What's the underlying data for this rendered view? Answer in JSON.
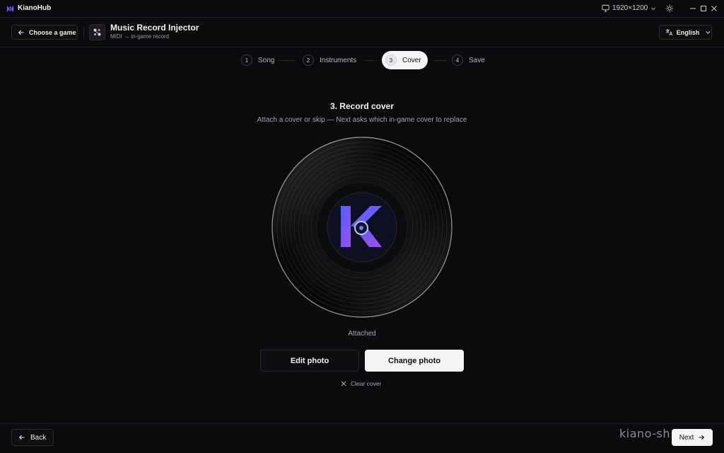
{
  "app": {
    "name": "KianoHub",
    "resolution": "1920×1200"
  },
  "icons": {
    "app_logo": "kianohub-logo-icon",
    "monitor": "monitor-icon",
    "sun": "sun-icon",
    "minimize": "minimize-icon",
    "maximize": "maximize-icon",
    "close": "close-icon",
    "back_arrow": "arrow-left-icon",
    "translate": "translate-icon",
    "chevron": "chevron-down-icon",
    "clear": "x-icon",
    "next_arrow": "arrow-right-icon"
  },
  "header": {
    "choose_game": "Choose a game",
    "tool_title": "Music Record Injector",
    "tool_subtitle": "MIDI → in-game record",
    "language": "English"
  },
  "steps": [
    {
      "num": "1",
      "label": "Song",
      "active": false
    },
    {
      "num": "2",
      "label": "Instruments",
      "active": false
    },
    {
      "num": "3",
      "label": "Cover",
      "active": true
    },
    {
      "num": "4",
      "label": "Save",
      "active": false
    }
  ],
  "content": {
    "title": "3. Record cover",
    "description": "Attach a cover or skip — Next asks which in-game cover to replace",
    "status": "Attached",
    "edit_photo": "Edit photo",
    "change_photo": "Change photo",
    "clear_cover": "Clear cover"
  },
  "footer": {
    "back": "Back",
    "next": "Next",
    "watermark": "kiano-sh"
  },
  "colors": {
    "background": "#0b0b0d",
    "accent_light": "#f4f4f6",
    "logo_gradient_start": "#4a64ff",
    "logo_gradient_end": "#a24bf0"
  }
}
